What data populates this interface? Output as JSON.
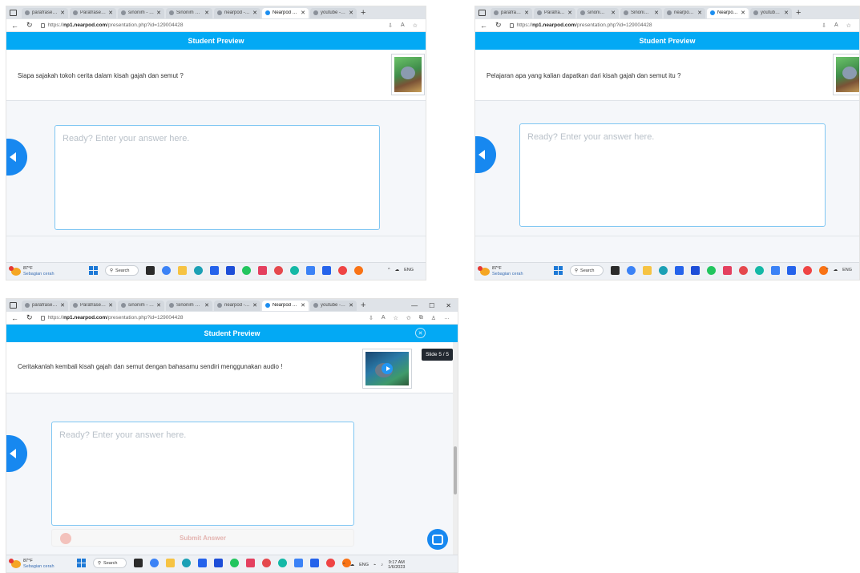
{
  "browser": {
    "tabs": [
      {
        "label": "parafrase - Sea"
      },
      {
        "label": "Parafrase - Alo"
      },
      {
        "label": "sinonim - Sear"
      },
      {
        "label": "Sinonim kaada"
      },
      {
        "label": "nearpod - Sear"
      },
      {
        "label": "Nearpod - Pre"
      },
      {
        "label": "youtube - Sear"
      }
    ],
    "active_tab": 5,
    "url_prefix": "https://",
    "url_host": "np1.nearpod.com",
    "url_path": "/presentation.php?id=129004428"
  },
  "header": {
    "title": "Student Preview"
  },
  "slides": [
    {
      "question": "Siapa sajakah tokoh cerita dalam kisah gajah dan semut ?"
    },
    {
      "question": "Pelajaran apa yang kalian dapatkan dari kisah gajah dan semut itu ?"
    },
    {
      "question": "Ceritakanlah kembali kisah gajah dan semut dengan bahasamu sendiri menggunakan audio !"
    }
  ],
  "answer": {
    "placeholder": "Ready? Enter your answer here."
  },
  "slide_counter": "Slide 5 / 5",
  "submit": {
    "label": "Submit Answer"
  },
  "taskbar": {
    "temperature": "87°F",
    "condition": "Sebagian cerah",
    "search_label": "Search",
    "language": "ENG",
    "time": "9:17 AM",
    "date": "1/6/2023"
  },
  "colors": {
    "accent": "#03a9f4",
    "button_blue": "#1788f0"
  },
  "icons": {
    "back": "chevron-left-icon",
    "chat": "chat-icon",
    "play": "play-icon"
  }
}
